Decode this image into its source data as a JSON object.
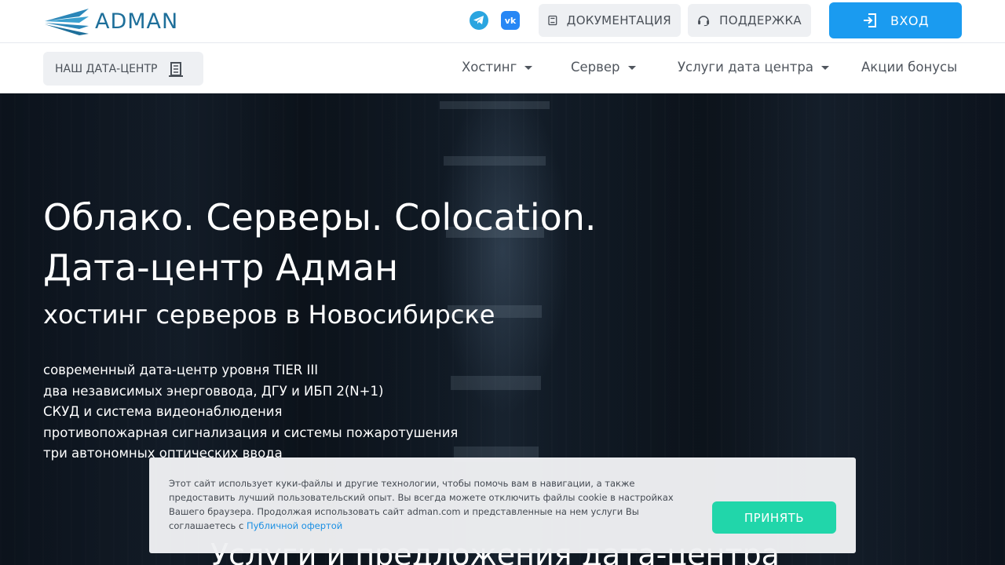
{
  "header": {
    "logo_text": "ADMAN",
    "social": {
      "telegram_icon": "telegram-icon",
      "vk_text": "vk"
    },
    "docs_label": "ДОКУМЕНТАЦИЯ",
    "support_label": "ПОДДЕРЖКА",
    "login_label": "ВХОД"
  },
  "nav": {
    "datacenter_label": "НАШ ДАТА-ЦЕНТР",
    "items": [
      {
        "label": "Хостинг"
      },
      {
        "label": "Сервер"
      },
      {
        "label": "Услуги дата центра"
      },
      {
        "label": "Акции бонусы"
      }
    ]
  },
  "hero": {
    "title_line1": "Облако. Серверы. Colocation.",
    "title_line2": "Дата-центр Адман",
    "subtitle": "хостинг серверов в Новосибирске",
    "features": [
      "современный дата-центр уровня TIER III",
      "два независимых энерговвода, ДГУ и ИБП 2(N+1)",
      "СКУД и система видеонаблюдения",
      "противопожарная сигнализация и системы пожаротушения",
      "три автономных оптических ввода"
    ],
    "section_title": "Услуги и предложения дата-центра"
  },
  "cookie": {
    "text": "Этот сайт использует куки-файлы и другие технологии, чтобы помочь вам в навигации, а также предоставить лучший пользовательский опыт. Вы всегда можете отключить файлы cookie в настройках Вашего браузера. Продолжая использовать сайт adman.com и представленные на нем услуги Вы соглашаетесь с ",
    "link": "Публичной офертой",
    "accept_label": "ПРИНЯТЬ"
  },
  "colors": {
    "brand": "#1e6f9a",
    "login_button": "#1a9bf0",
    "accept_button": "#21d6aa",
    "link": "#1a8fe3"
  }
}
